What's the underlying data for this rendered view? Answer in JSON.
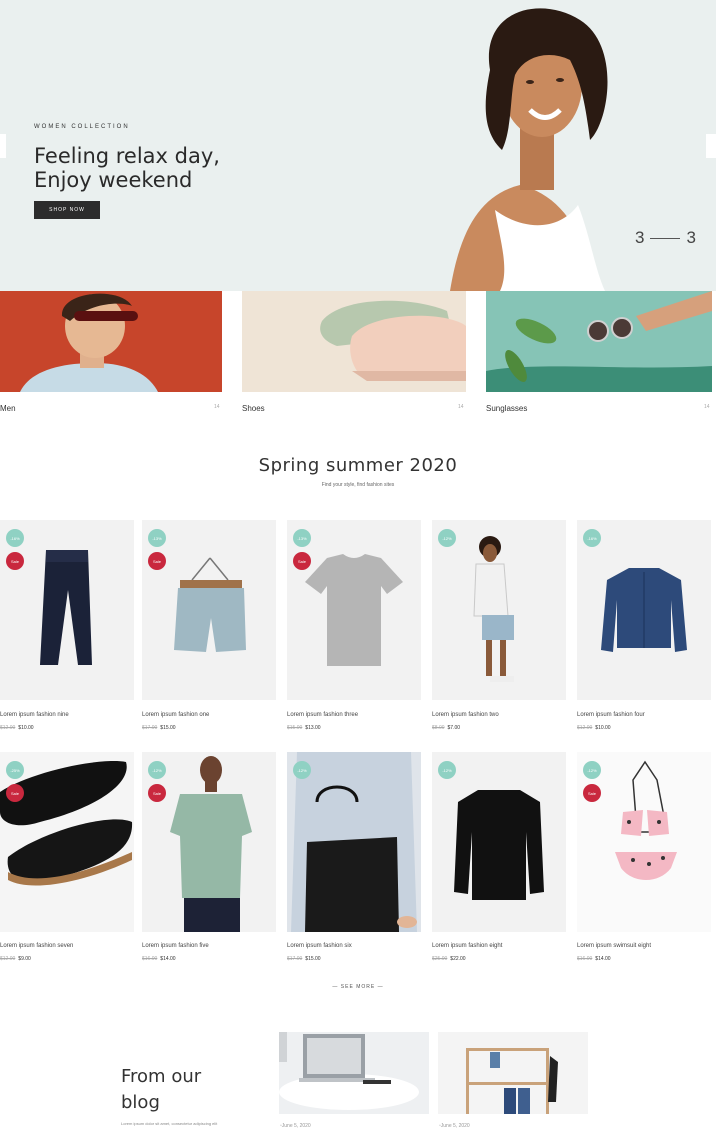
{
  "hero": {
    "kicker": "WOMEN COLLECTION",
    "title_line1": "Feeling relax day,",
    "title_line2": "Enjoy weekend",
    "button": "SHOP NOW",
    "counter_current": "3",
    "counter_total": "3"
  },
  "categories": [
    {
      "label": "Men",
      "count": "14"
    },
    {
      "label": "Shoes",
      "count": "14"
    },
    {
      "label": "Sunglasses",
      "count": "14"
    }
  ],
  "section": {
    "title": "Spring summer 2020",
    "subtitle": "Find your style, find fashion sites"
  },
  "products": [
    {
      "name": "Lorem ipsum fashion nine",
      "old": "$12.00",
      "price": "$10.00",
      "pct": "-16%",
      "sale": "Sale"
    },
    {
      "name": "Lorem ipsum fashion one",
      "old": "$17.00",
      "price": "$15.00",
      "pct": "-13%",
      "sale": "Sale"
    },
    {
      "name": "Lorem ipsum fashion three",
      "old": "$15.00",
      "price": "$13.00",
      "pct": "-13%",
      "sale": "Sale"
    },
    {
      "name": "Lorem ipsum fashion two",
      "old": "$8.00",
      "price": "$7.00",
      "pct": "-12%",
      "sale": ""
    },
    {
      "name": "Lorem ipsum fashion four",
      "old": "$12.00",
      "price": "$10.00",
      "pct": "-16%",
      "sale": ""
    },
    {
      "name": "Lorem ipsum fashion seven",
      "old": "$12.00",
      "price": "$9.00",
      "pct": "-25%",
      "sale": "Sale"
    },
    {
      "name": "Lorem ipsum fashion five",
      "old": "$16.00",
      "price": "$14.00",
      "pct": "-12%",
      "sale": "Sale"
    },
    {
      "name": "Lorem ipsum fashion six",
      "old": "$17.00",
      "price": "$15.00",
      "pct": "-12%",
      "sale": ""
    },
    {
      "name": "Lorem ipsum fashion eight",
      "old": "$25.00",
      "price": "$22.00",
      "pct": "-12%",
      "sale": ""
    },
    {
      "name": "Lorem ipsum swimsuit eight",
      "old": "$16.00",
      "price": "$14.00",
      "pct": "-12%",
      "sale": "Sale"
    }
  ],
  "see_more": "SEE MORE",
  "blog": {
    "title_line1": "From our",
    "title_line2": "blog",
    "subtitle": "Lorem ipsum dolor sit amet, consectetur adipiscing elit",
    "dates": [
      "June 5, 2020",
      "June 5, 2020"
    ]
  },
  "colors": {
    "hero_bg": "#eaf0ef",
    "badge_pct": "#8fd1c3",
    "badge_sale": "#c9283e",
    "dark_button": "#2c2c2c"
  }
}
